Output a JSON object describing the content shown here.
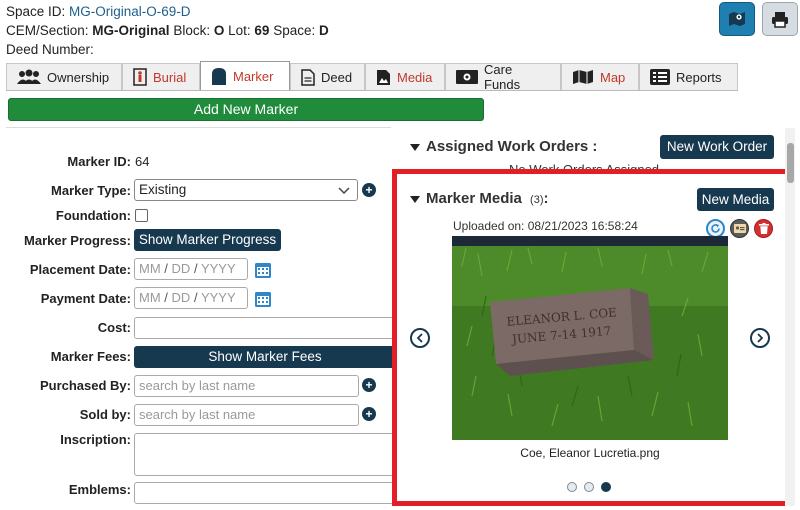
{
  "header": {
    "space_id_label": "Space ID:",
    "space_id_value": "MG-Original-O-69-D",
    "cem_label": "CEM/Section:",
    "cem_value": "MG-Original",
    "block_label": "Block:",
    "block_value": "O",
    "lot_label": "Lot:",
    "lot_value": "69",
    "space_label": "Space:",
    "space_value": "D",
    "deed_label": "Deed Number:"
  },
  "tabs": [
    {
      "label": "Ownership"
    },
    {
      "label": "Burial"
    },
    {
      "label": "Marker"
    },
    {
      "label": "Deed"
    },
    {
      "label": "Media"
    },
    {
      "label": "Care Funds"
    },
    {
      "label": "Map"
    },
    {
      "label": "Reports"
    }
  ],
  "add_marker_label": "Add New Marker",
  "form": {
    "marker_id_label": "Marker ID:",
    "marker_id_value": "64",
    "marker_type_label": "Marker Type:",
    "marker_type_value": "Existing",
    "foundation_label": "Foundation:",
    "progress_label": "Marker Progress:",
    "progress_button": "Show Marker Progress",
    "placement_label": "Placement Date:",
    "payment_label": "Payment Date:",
    "date_mm": "MM",
    "date_dd": "DD",
    "date_yyyy": "YYYY",
    "date_sep": "/",
    "cost_label": "Cost:",
    "fees_label": "Marker Fees:",
    "fees_button": "Show Marker Fees",
    "purchased_label": "Purchased By:",
    "sold_label": "Sold by:",
    "search_placeholder": "search by last name",
    "inscription_label": "Inscription:",
    "emblems_label": "Emblems:"
  },
  "work_orders": {
    "title": "Assigned Work Orders :",
    "button": "New Work Order",
    "empty": "No Work Orders Assigned"
  },
  "media": {
    "title": "Marker Media",
    "count": "(3)",
    "colon": ":",
    "button": "New Media",
    "uploaded": "Uploaded on: 08/21/2023 16:58:24",
    "caption": "Coe, Eleanor Lucretia.png",
    "stone_line1": "ELEANOR L. COE",
    "stone_line2": "JUNE 7-14 1917"
  },
  "colors": {
    "accent": "#17394f",
    "green": "#1f8b3b",
    "highlight": "#e21e26",
    "link": "#1f5f8b"
  }
}
